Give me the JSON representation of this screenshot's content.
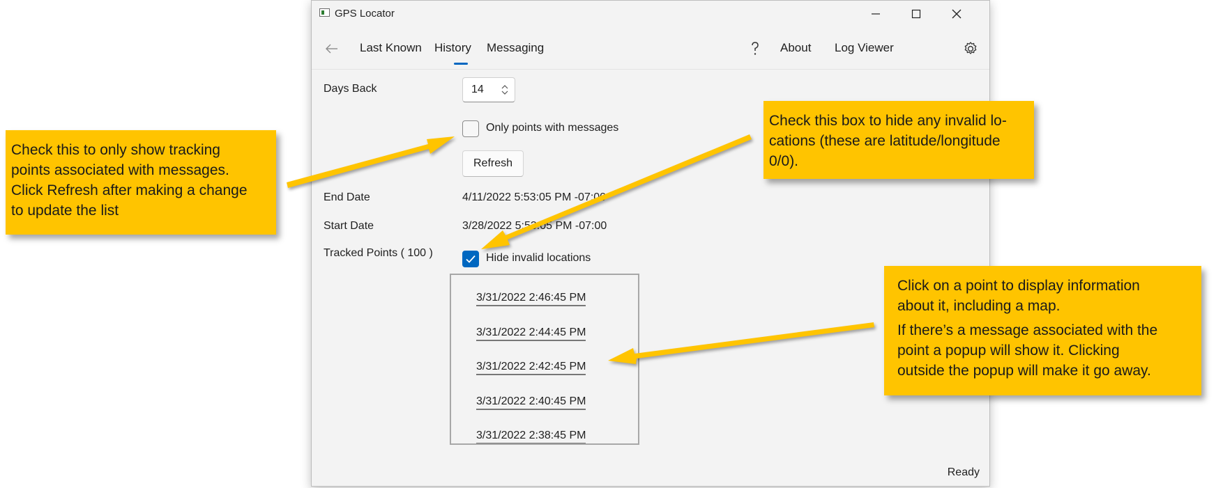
{
  "window": {
    "title": "GPS Locator",
    "nav": {
      "items": [
        "Last Known",
        "History",
        "Messaging"
      ],
      "selected": "History",
      "right_items": [
        "About",
        "Log Viewer"
      ]
    },
    "form": {
      "days_back_label": "Days Back",
      "days_back_value": "14",
      "only_messages_label": "Only points with messages",
      "only_messages_checked": false,
      "refresh_label": "Refresh",
      "end_date_label": "End Date",
      "end_date_value": "4/11/2022 5:53:05 PM -07:00",
      "start_date_label": "Start Date",
      "start_date_value": "3/28/2022 5:53:05 PM -07:00",
      "tracked_points_label": "Tracked Points ( 100 )",
      "hide_invalid_label": "Hide invalid locations",
      "hide_invalid_checked": true
    },
    "points": [
      "3/31/2022 2:46:45 PM",
      "3/31/2022 2:44:45 PM",
      "3/31/2022 2:42:45 PM",
      "3/31/2022 2:40:45 PM",
      "3/31/2022 2:38:45 PM"
    ],
    "status": "Ready"
  },
  "callouts": {
    "left": {
      "lines": [
        "Check this to only show tracking",
        "points associated with messages.",
        "Click Refresh after making a change",
        "to update the list"
      ]
    },
    "middle": {
      "lines": [
        "Check this box to hide any invalid lo-",
        "cations (these are latitude/longitude",
        "0/0)."
      ]
    },
    "right": {
      "lines": [
        "Click on a point to display information",
        "about it, including a map.",
        "If there’s a message associated with the",
        "point a popup will show it. Clicking",
        "outside the popup will make it go away."
      ]
    }
  },
  "colors": {
    "callout": "#ffc400",
    "accent": "#0067c0",
    "window_bg": "#f3f3f3"
  },
  "icons": {
    "back": "back-arrow-icon",
    "help": "question-mark-icon",
    "settings": "gear-icon",
    "minimize": "minimize-icon",
    "maximize": "maximize-icon",
    "close": "close-icon"
  }
}
